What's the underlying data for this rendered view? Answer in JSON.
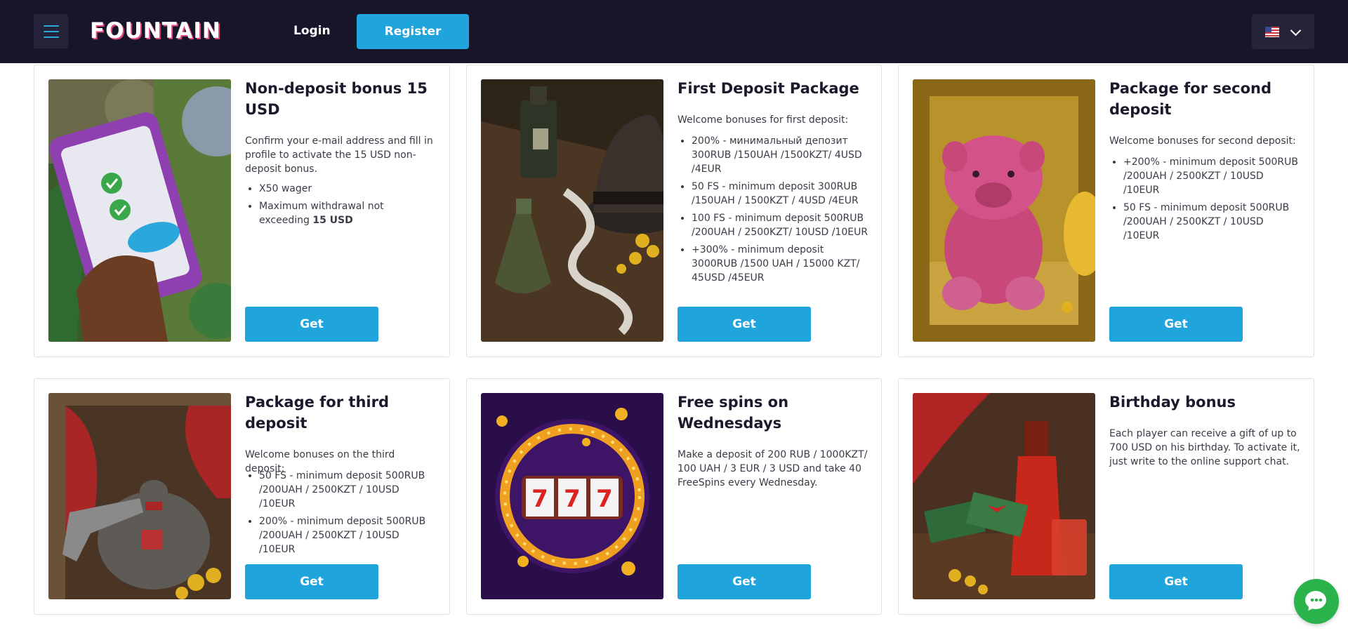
{
  "header": {
    "logo": "FOUNTAIN",
    "login_label": "Login",
    "register_label": "Register",
    "language": "en-US flag"
  },
  "colors": {
    "header_bg": "#17152a",
    "accent": "#1fa4dc",
    "chat": "#2ab34a"
  },
  "bonuses": [
    {
      "title": "Non-deposit bonus 15 USD",
      "description": "Confirm your e-mail address and fill in profile to activate the 15 USD non-deposit bonus.",
      "items": [
        "X50 wager",
        "Maximum withdrawal not exceeding "
      ],
      "item_bold": "15 USD",
      "button": "Get",
      "image": "phone-verification-illustration"
    },
    {
      "title": "First Deposit Package",
      "description": "Welcome bonuses for first deposit:",
      "items": [
        "200% - минимальный депозит 300RUB /150UAH /1500KZT/ 4USD /4EUR",
        "50 FS - minimum deposit 300RUB /150UAH / 1500KZT / 4USD /4EUR",
        "100 FS - minimum deposit 500RUB /200UAH / 2500KZT/ 10USD /10EUR",
        "+300% - minimum deposit 3000RUB /1500 UAH / 15000 KZT/ 45USD /45EUR"
      ],
      "button": "Get",
      "image": "hat-and-bottles-illustration"
    },
    {
      "title": "Package for second deposit",
      "description": "Welcome bonuses for second deposit:",
      "items": [
        "+200% - minimum deposit 500RUB /200UAH / 2500KZT / 10USD /10EUR",
        "50 FS - minimum deposit 500RUB /200UAH / 2500KZT / 10USD /10EUR"
      ],
      "button": "Get",
      "image": "pink-teddy-in-crate-illustration"
    },
    {
      "title": "Package for third deposit",
      "description": "Welcome bonuses on the third deposit:",
      "items": [
        "50 FS - minimum deposit 500RUB /200UAH / 2500KZT / 10USD /10EUR",
        "200% - minimum deposit 500RUB /200UAH / 2500KZT / 10USD /10EUR"
      ],
      "button": "Get",
      "image": "money-bag-and-revolver-illustration"
    },
    {
      "title": "Free spins on Wednesdays",
      "description": "Make a deposit of 200 RUB / 1000KZT/ 100 UAH / 3 EUR / 3 USD and take 40 FreeSpins every Wednesday.",
      "slot_symbols": [
        "7",
        "7",
        "7"
      ],
      "button": "Get",
      "image": "slot-machine-777-illustration"
    },
    {
      "title": "Birthday bonus",
      "description": "Each player can receive a gift of up to 700 USD on his birthday. To activate it, just write to the online support chat.",
      "button": "Get",
      "image": "gift-money-and-bottle-illustration"
    }
  ]
}
